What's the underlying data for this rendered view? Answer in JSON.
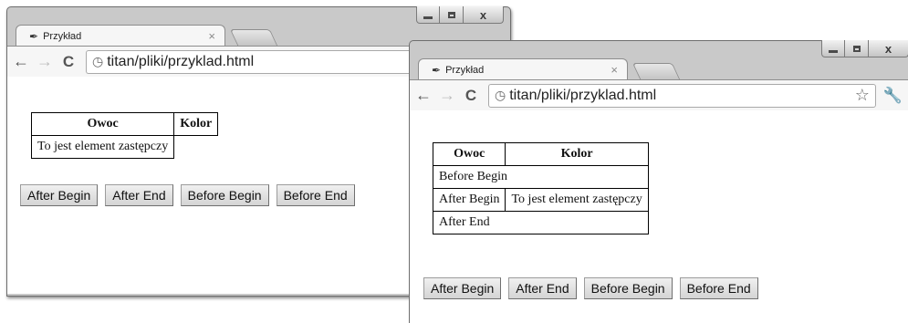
{
  "window_controls": {
    "minimize": "_",
    "close": "x"
  },
  "tab": {
    "title": "Przykład",
    "close": "×"
  },
  "toolbar": {
    "url": "titan/pliki/przyklad.html"
  },
  "buttons": [
    "After Begin",
    "After End",
    "Before Begin",
    "Before End"
  ],
  "before": {
    "headers": [
      "Owoc",
      "Kolor"
    ],
    "placeholder": "To jest element zastępczy"
  },
  "after": {
    "headers": [
      "Owoc",
      "Kolor"
    ],
    "row_before_begin": "Before Begin",
    "row_after_begin": "After Begin",
    "placeholder": "To jest element zastępczy",
    "row_after_end": "After End"
  }
}
